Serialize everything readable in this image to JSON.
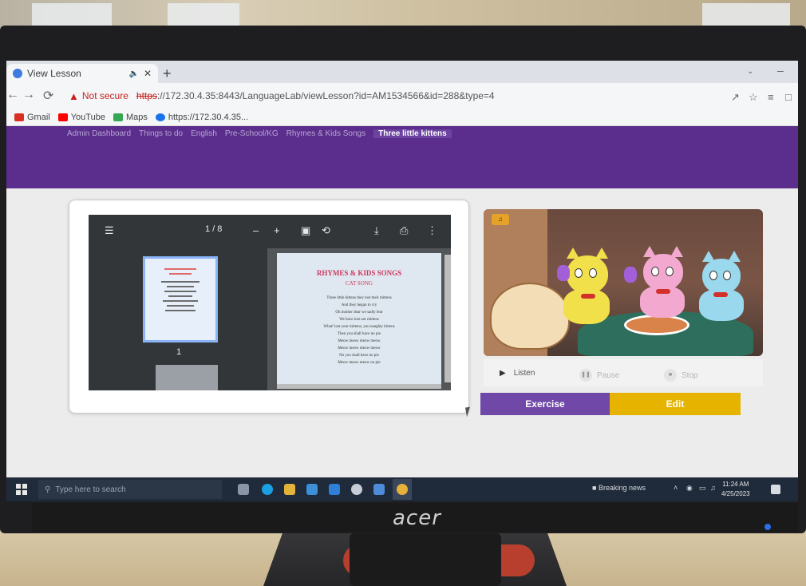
{
  "browser": {
    "tab_title": "View Lesson",
    "new_tab": "+",
    "address": {
      "warning": "Not secure",
      "url_scheme": "https",
      "url_rest": "://172.30.4.35:8443/LanguageLab/viewLesson?id=AM1534566&id=288&type=4"
    },
    "bookmarks": [
      {
        "label": "Gmail",
        "color": "#d93025"
      },
      {
        "label": "YouTube",
        "color": "#ff0000"
      },
      {
        "label": "Maps",
        "color": "#34a853"
      },
      {
        "label": "https://172.30.4.35...",
        "color": "#1a73e8"
      }
    ]
  },
  "page": {
    "breadcrumb": [
      "Admin Dashboard",
      "Things to do",
      "English",
      "Pre-School/KG",
      "Rhymes & Kids Songs",
      "Three little kittens"
    ],
    "pdf_viewer": {
      "page_indicator": "1 / 8",
      "thumbnail_page_number": "1",
      "doc_title": "RHYMES & KIDS SONGS",
      "doc_subtitle": "CAT SONG",
      "doc_lines": [
        "Three little kittens they lost their mittens",
        "And they began to cry",
        "Oh mother dear we sadly fear",
        "We have lost our mittens",
        "What! lost your mittens, you naughty kittens",
        "Then you shall have no pie",
        "Meow meow meow meow",
        "Meow meow meow meow",
        "No you shall have no pie",
        "Meow meow meow no pie"
      ]
    },
    "audio": {
      "listen_label": "Listen",
      "pause_label": "Pause",
      "stop_label": "Stop"
    },
    "buttons": {
      "exercise_label": "Exercise",
      "edit_label": "Edit"
    },
    "colors": {
      "header_purple": "#5b2d8c",
      "exercise_purple": "#6f48a8",
      "edit_yellow": "#e5b300"
    }
  },
  "taskbar": {
    "search_placeholder": "Type here to search",
    "news_label": "Breaking news",
    "time": "11:24 AM",
    "date": "4/25/2023"
  },
  "monitor": {
    "brand": "acer"
  }
}
